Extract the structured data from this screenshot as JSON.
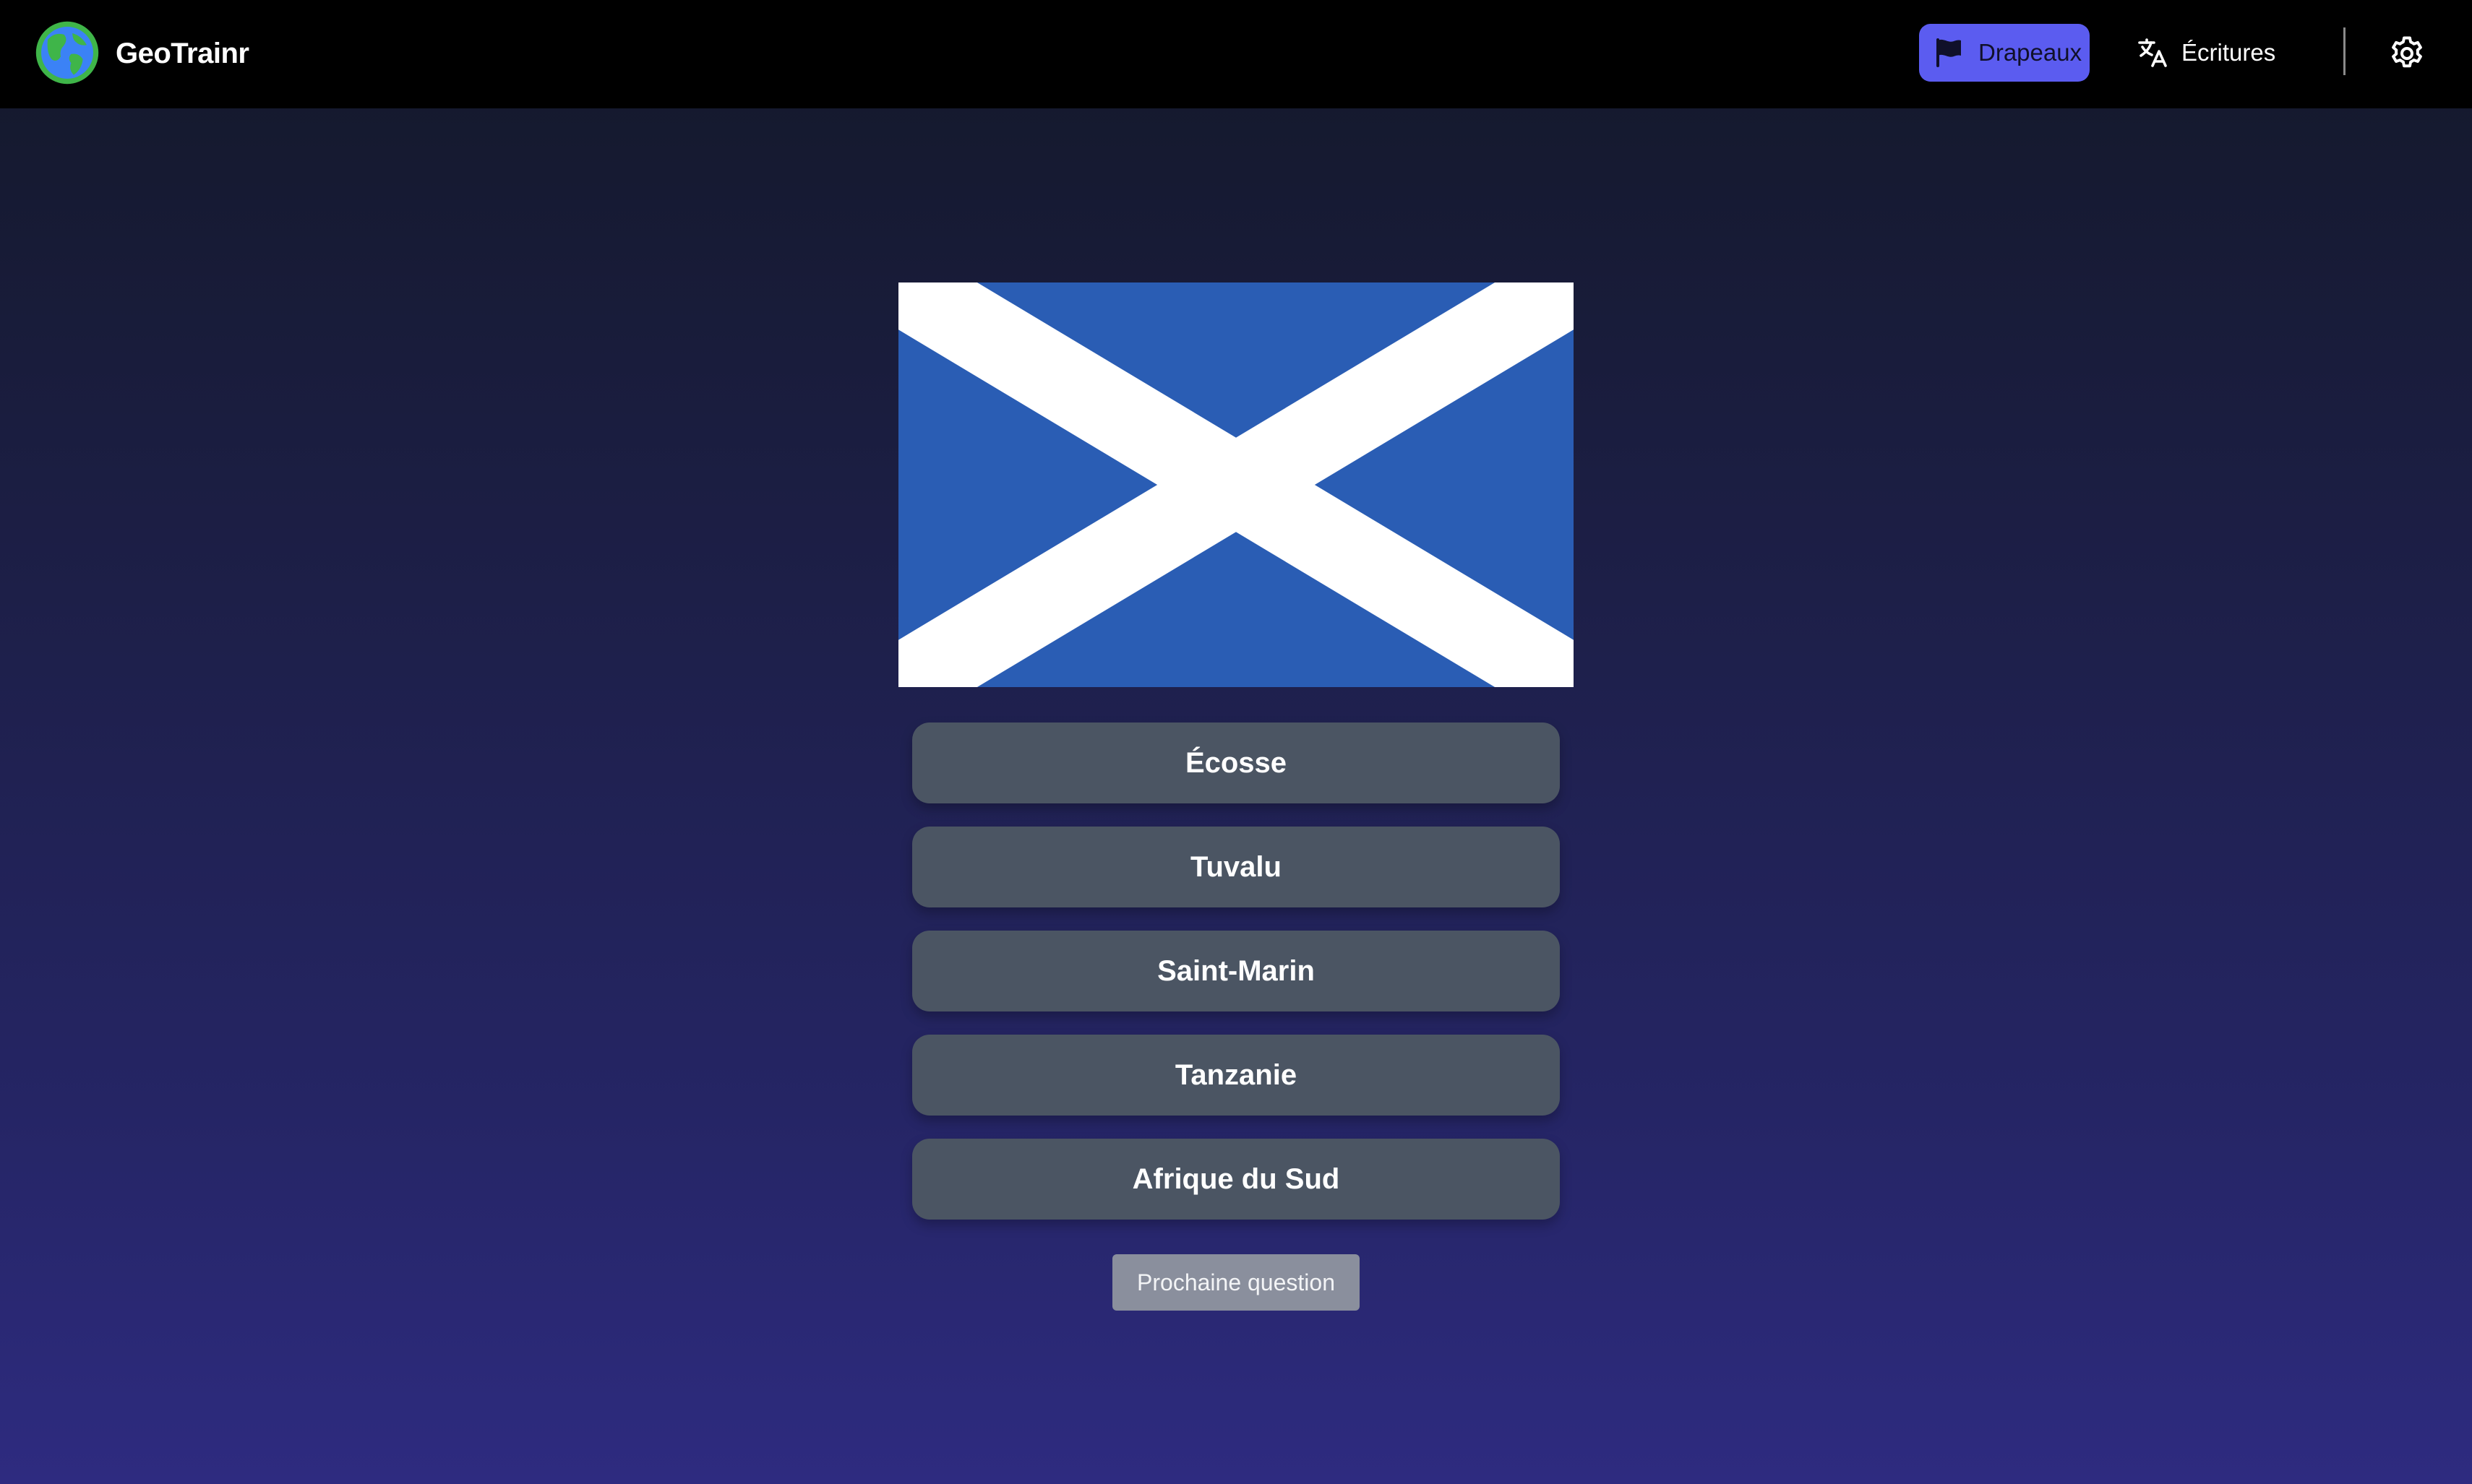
{
  "app": {
    "brand": "GeoTrainr"
  },
  "nav": {
    "items": [
      {
        "label": "Drapeaux",
        "icon": "flag-icon",
        "active": true
      },
      {
        "label": "Écritures",
        "icon": "translate-icon",
        "active": false
      }
    ],
    "settings_icon": "gear-icon",
    "active_color": "#5b5cf0"
  },
  "quiz": {
    "flag": {
      "icon": "scotland-flag",
      "colors": {
        "field": "#2a5db4",
        "saltire": "#ffffff"
      }
    },
    "answers": [
      {
        "label": "Écosse"
      },
      {
        "label": "Tuvalu"
      },
      {
        "label": "Saint-Marin"
      },
      {
        "label": "Tanzanie"
      },
      {
        "label": "Afrique du Sud"
      }
    ],
    "answer_color": "#4b5563",
    "next_label": "Prochaine question"
  }
}
